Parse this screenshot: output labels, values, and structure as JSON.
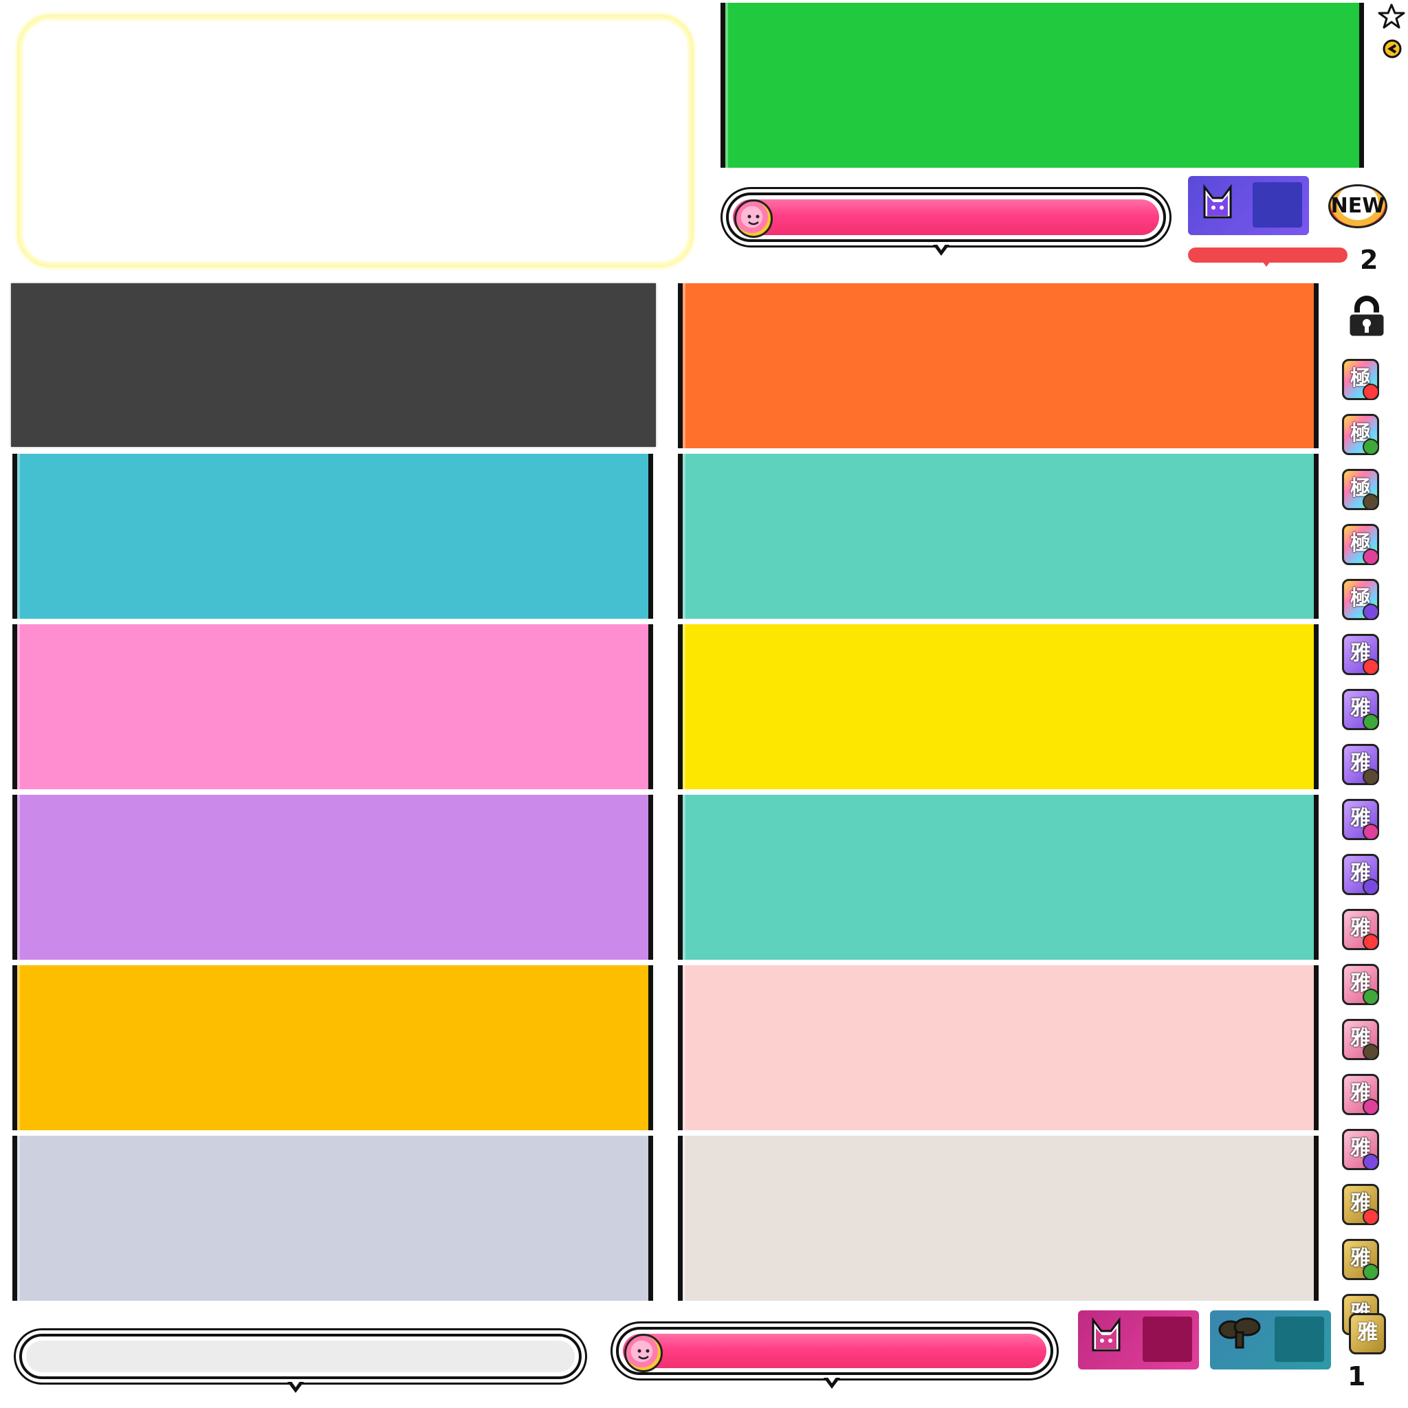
{
  "colors": {
    "green_banner": "#21c93f",
    "gauge_pink": "#ff3e86",
    "status_bar_red": "#f0474c"
  },
  "badges": {
    "new_label": "NEW",
    "count_top": "2",
    "count_bottom": "1"
  },
  "gauges": {
    "top_level_percent": 100,
    "bottom_level_percent": 100,
    "empty_level_percent": 0
  },
  "plates": {
    "left": [
      {
        "name": "plate-dark",
        "color": "#414141"
      },
      {
        "name": "plate-cyan",
        "color": "#44c0d0"
      },
      {
        "name": "plate-pink",
        "color": "#ff8ed0"
      },
      {
        "name": "plate-purple",
        "color": "#cb8aea"
      },
      {
        "name": "plate-amber",
        "color": "#fdbe00"
      },
      {
        "name": "plate-lavender-grey",
        "color": "#cdd0df"
      }
    ],
    "right": [
      {
        "name": "plate-orange",
        "color": "#fe702b"
      },
      {
        "name": "plate-teal",
        "color": "#5ed2bd"
      },
      {
        "name": "plate-yellow",
        "color": "#fde600"
      },
      {
        "name": "plate-teal-2",
        "color": "#5ed2bd"
      },
      {
        "name": "plate-light-pink",
        "color": "#fdd0d0"
      },
      {
        "name": "plate-beige",
        "color": "#e8e0db"
      }
    ]
  },
  "tier_icons": {
    "kiwami_glyph": "極",
    "miyabi_glyph": "雅",
    "kiwami": [
      {
        "accent": "#ff3b3b"
      },
      {
        "accent": "#3fa83a"
      },
      {
        "accent": "#5a4a32"
      },
      {
        "accent": "#e0409c"
      },
      {
        "accent": "#7a4ae0"
      }
    ],
    "miyabi_purple": [
      {
        "accent": "#ff3b3b"
      },
      {
        "accent": "#3fa83a"
      },
      {
        "accent": "#5a4a32"
      },
      {
        "accent": "#e0409c"
      },
      {
        "accent": "#7a4ae0"
      }
    ],
    "miyabi_pink": [
      {
        "accent": "#ff3b3b"
      },
      {
        "accent": "#3fa83a"
      },
      {
        "accent": "#5a4a32"
      },
      {
        "accent": "#e0409c"
      },
      {
        "accent": "#7a4ae0"
      }
    ],
    "miyabi_gold": [
      {
        "accent": "#ff3b3b"
      },
      {
        "accent": "#3fa83a"
      },
      {
        "accent": "#5a4a32"
      }
    ]
  }
}
